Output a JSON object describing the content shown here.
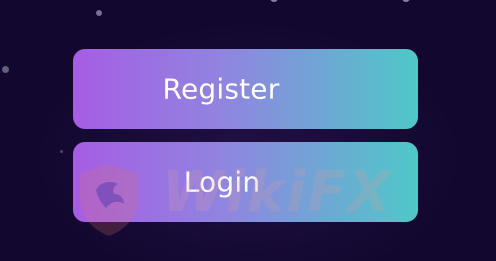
{
  "actions": {
    "register_label": "Register",
    "login_label": "Login"
  },
  "watermark": {
    "text": "WikiFX",
    "icon": "wikifx-shield-icon"
  },
  "colors": {
    "background": "#12082f",
    "gradient_start": "#a65de3",
    "gradient_end": "#4ec8c8",
    "label": "#ffffff"
  }
}
